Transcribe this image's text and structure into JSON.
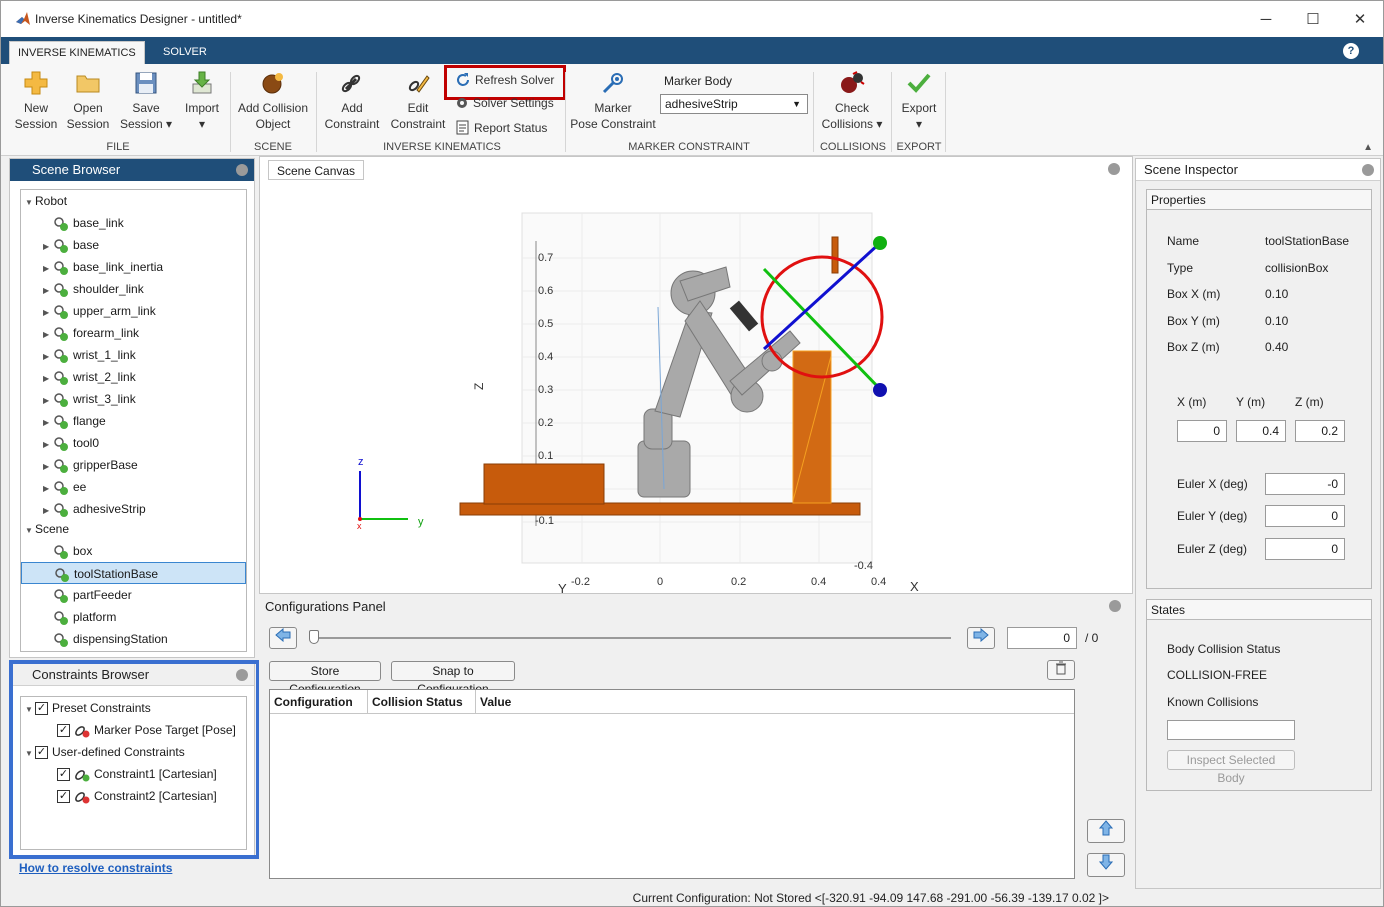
{
  "window": {
    "title": "Inverse Kinematics Designer - untitled*",
    "minimize": "─",
    "maximize": "☐",
    "close": "✕"
  },
  "tabs": [
    "INVERSE KINEMATICS",
    "SOLVER"
  ],
  "help": "?",
  "toolstrip": {
    "new_session": [
      "New",
      "Session"
    ],
    "open_session": [
      "Open",
      "Session"
    ],
    "save_session": [
      "Save",
      "Session ▾"
    ],
    "import": [
      "Import",
      "▾"
    ],
    "add_collision": [
      "Add Collision",
      "Object"
    ],
    "add_constraint": [
      "Add",
      "Constraint"
    ],
    "edit_constraint": [
      "Edit",
      "Constraint"
    ],
    "refresh_solver": "Refresh Solver",
    "solver_settings": "Solver Settings",
    "report_status": "Report Status",
    "marker_pose": [
      "Marker",
      "Pose Constraint"
    ],
    "marker_body_label": "Marker Body",
    "marker_body_value": "adhesiveStrip",
    "check_collisions": [
      "Check",
      "Collisions ▾"
    ],
    "export": [
      "Export",
      "▾"
    ],
    "sections": {
      "file": "FILE",
      "scene": "SCENE",
      "ik": "INVERSE KINEMATICS",
      "marker": "MARKER CONSTRAINT",
      "collisions": "COLLISIONS",
      "export": "EXPORT"
    }
  },
  "scene_browser": {
    "title": "Scene Browser",
    "robot_label": "Robot",
    "robot_items": [
      "base_link",
      "base",
      "base_link_inertia",
      "shoulder_link",
      "upper_arm_link",
      "forearm_link",
      "wrist_1_link",
      "wrist_2_link",
      "wrist_3_link",
      "flange",
      "tool0",
      "gripperBase",
      "ee",
      "adhesiveStrip"
    ],
    "scene_label": "Scene",
    "scene_items": [
      "box",
      "toolStationBase",
      "partFeeder",
      "platform",
      "dispensingStation"
    ]
  },
  "constraints_browser": {
    "title": "Constraints Browser",
    "preset": "Preset Constraints",
    "preset_items": [
      "Marker Pose Target [Pose]"
    ],
    "user": "User-defined Constraints",
    "user_items": [
      "Constraint1 [Cartesian]",
      "Constraint2 [Cartesian]"
    ],
    "link": "How to resolve constraints"
  },
  "canvas": {
    "tab": "Scene Canvas",
    "z_ticks": [
      "0.7",
      "0.6",
      "0.5",
      "0.4",
      "0.3",
      "0.2",
      "0.1",
      "-0.1"
    ],
    "x_ticks": [
      "-0.2",
      "0",
      "0.2",
      "0.4",
      "0.4"
    ],
    "side_tick": "-0.4",
    "zlabel": "Z",
    "xlabel": "X",
    "ylabel": "Y",
    "triad": {
      "z": "z",
      "y": "y",
      "x": "x"
    }
  },
  "config_panel": {
    "title": "Configurations Panel",
    "slider_value": "0",
    "slider_total": "/ 0",
    "store": "Store Configuration",
    "snap": "Snap to Configuration",
    "columns": [
      "Configuration",
      "Collision Status",
      "Value"
    ]
  },
  "inspector": {
    "title": "Scene Inspector",
    "properties_title": "Properties",
    "props": [
      [
        "Name",
        "toolStationBase"
      ],
      [
        "Type",
        "collisionBox"
      ],
      [
        "Box X (m)",
        "0.10"
      ],
      [
        "Box Y (m)",
        "0.10"
      ],
      [
        "Box Z (m)",
        "0.40"
      ]
    ],
    "xyz_labels": [
      "X (m)",
      "Y (m)",
      "Z (m)"
    ],
    "xyz_values": [
      "0",
      "0.4",
      "0.2"
    ],
    "euler": [
      [
        "Euler X (deg)",
        "-0"
      ],
      [
        "Euler Y (deg)",
        "0"
      ],
      [
        "Euler Z (deg)",
        "0"
      ]
    ],
    "states_title": "States",
    "body_collision_label": "Body Collision Status",
    "body_collision_value": "COLLISION-FREE",
    "known_collisions": "Known Collisions",
    "inspect_button": "Inspect Selected Body"
  },
  "status_bar": "Current Configuration: Not Stored <[-320.91 -94.09 147.68 -291.00 -56.39 -139.17 0.02 ]>",
  "colors": {
    "accent": "#1f4e79",
    "highlight_red": "#c00000",
    "highlight_blue": "#3a6fd0",
    "selection": "#cde4f7"
  }
}
